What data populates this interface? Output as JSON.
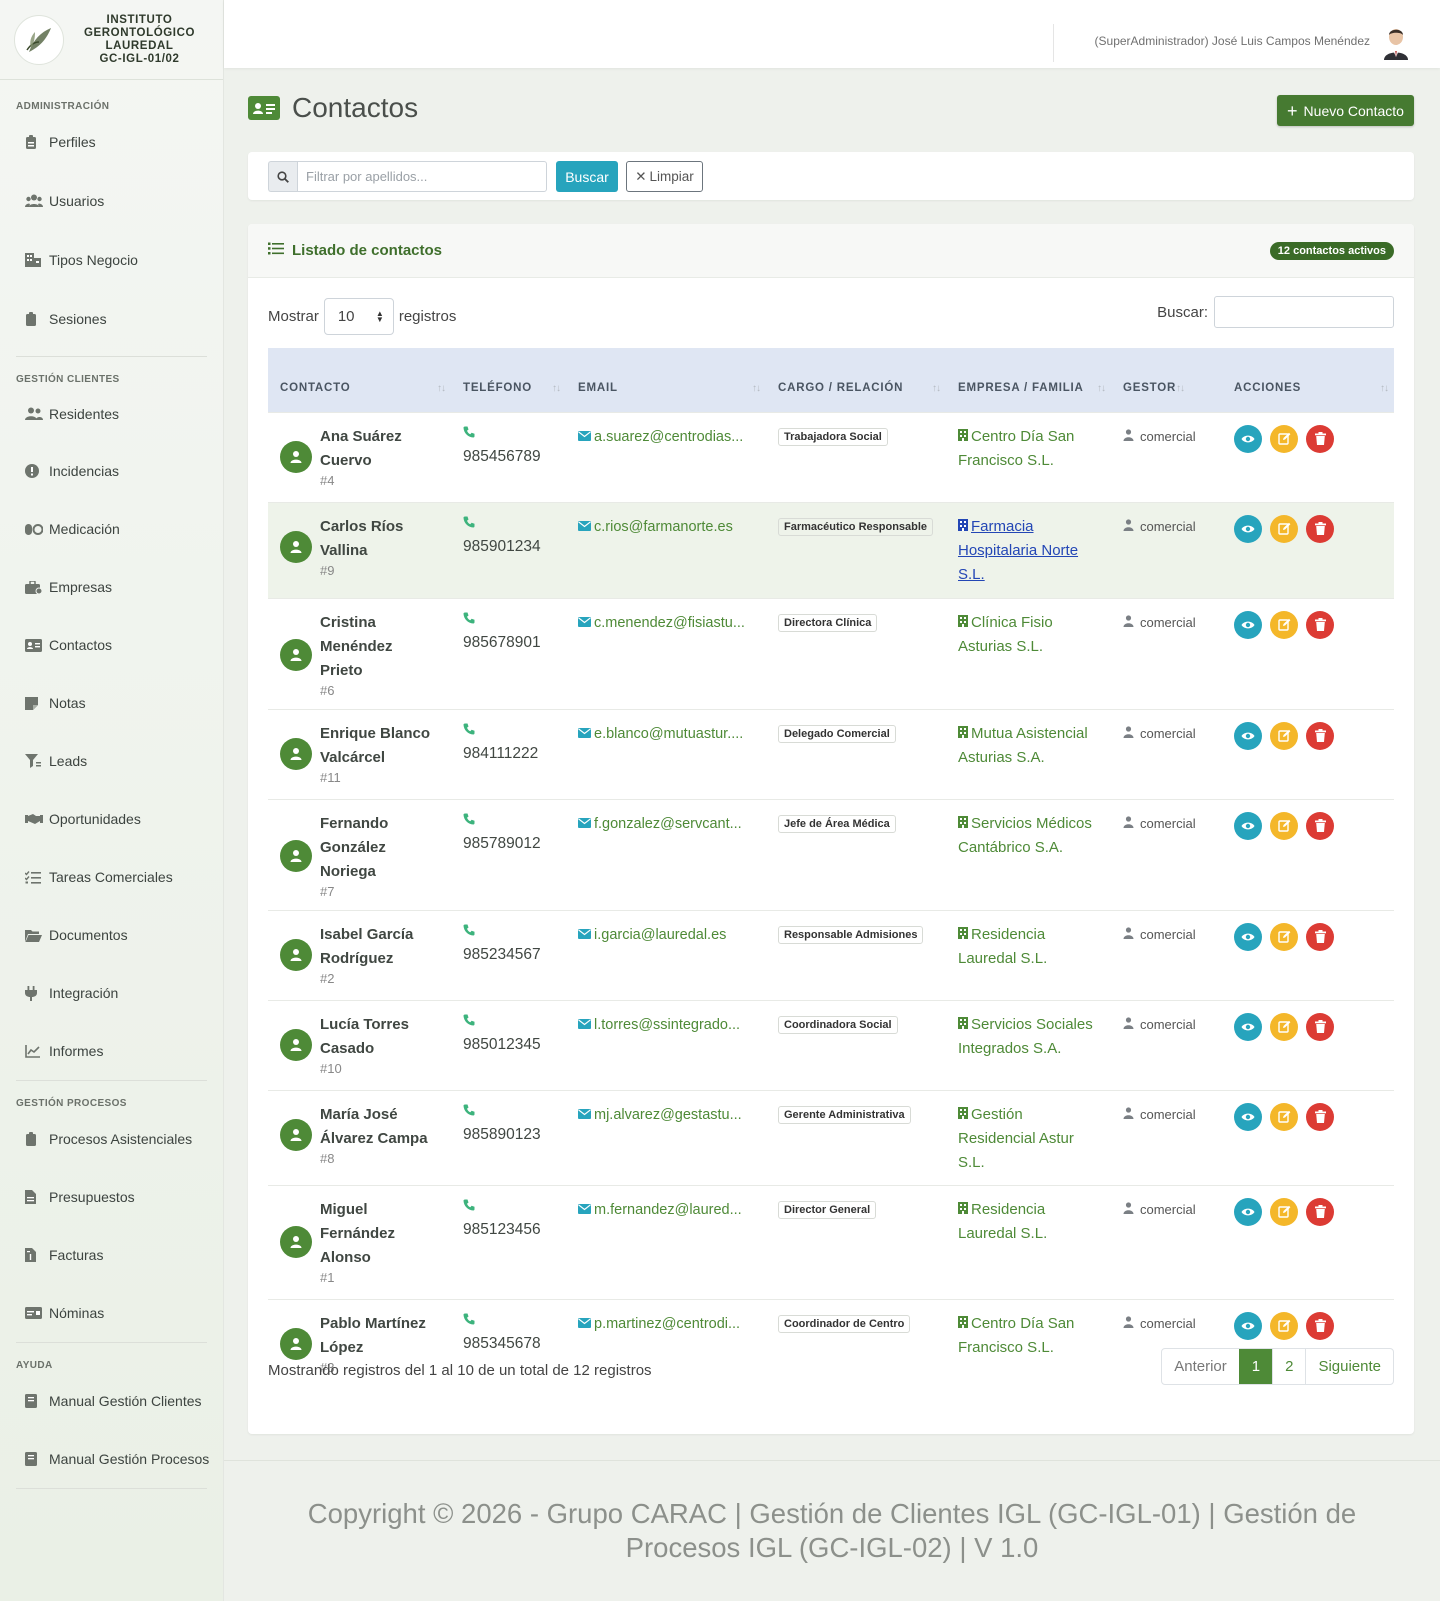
{
  "brand": {
    "lines": [
      "INSTITUTO",
      "GERONTOLÓGICO",
      "LAUREDAL",
      "GC-IGL-01/02"
    ],
    "logo_icon": "leaf-logo-icon"
  },
  "sidebar": {
    "sections": [
      {
        "title": "ADMINISTRACIÓN",
        "items": [
          {
            "label": "Perfiles",
            "icon": "id-badge-icon"
          },
          {
            "label": "Usuarios",
            "icon": "users-icon"
          },
          {
            "label": "Tipos Negocio",
            "icon": "building-icon"
          },
          {
            "label": "Sesiones",
            "icon": "clipboard-icon"
          }
        ]
      },
      {
        "title": "GESTIÓN CLIENTES",
        "items": [
          {
            "label": "Residentes",
            "icon": "user-group-icon"
          },
          {
            "label": "Incidencias",
            "icon": "alert-circle-icon"
          },
          {
            "label": "Medicación",
            "icon": "pills-icon"
          },
          {
            "label": "Empresas",
            "icon": "briefcase-icon"
          },
          {
            "label": "Contactos",
            "icon": "address-card-icon"
          },
          {
            "label": "Notas",
            "icon": "note-icon"
          },
          {
            "label": "Leads",
            "icon": "funnel-icon"
          },
          {
            "label": "Oportunidades",
            "icon": "handshake-icon"
          },
          {
            "label": "Tareas Comerciales",
            "icon": "tasks-icon"
          },
          {
            "label": "Documentos",
            "icon": "folder-open-icon"
          },
          {
            "label": "Integración",
            "icon": "plug-icon"
          },
          {
            "label": "Informes",
            "icon": "chart-line-icon"
          }
        ]
      },
      {
        "title": "GESTIÓN PROCESOS",
        "items": [
          {
            "label": "Procesos Asistenciales",
            "icon": "clipboard-icon"
          },
          {
            "label": "Presupuestos",
            "icon": "file-invoice-icon"
          },
          {
            "label": "Facturas",
            "icon": "file-invoice-dollar-icon"
          },
          {
            "label": "Nóminas",
            "icon": "money-check-icon"
          }
        ]
      },
      {
        "title": "AYUDA",
        "items": [
          {
            "label": "Manual Gestión Clientes",
            "icon": "book-icon"
          },
          {
            "label": "Manual Gestión Procesos",
            "icon": "book-icon"
          }
        ]
      }
    ]
  },
  "topbar": {
    "user": "(SuperAdministrador) José Luis Campos Menéndez"
  },
  "page": {
    "title": "Contactos",
    "new_button": "Nuevo Contacto"
  },
  "filter": {
    "placeholder": "Filtrar por apellidos...",
    "search_button": "Buscar",
    "clear_button": "Limpiar"
  },
  "list": {
    "title": "Listado de contactos",
    "badge": "12 contactos activos",
    "show_label": "Mostrar",
    "page_size": "10",
    "records_label": "registros",
    "search_label": "Buscar:",
    "columns": [
      "CONTACTO",
      "TELÉFONO",
      "EMAIL",
      "CARGO / RELACIÓN",
      "EMPRESA / FAMILIA",
      "GESTOR",
      "ACCIONES"
    ],
    "rows": [
      {
        "name": "Ana Suárez Cuervo",
        "id": "#4",
        "phone": "985456789",
        "email": "a.suarez@centrodias...",
        "cargo": "Trabajadora Social",
        "empresa": "Centro Día San Francisco S.L.",
        "gestor": "comercial"
      },
      {
        "name": "Carlos Ríos Vallina",
        "id": "#9",
        "phone": "985901234",
        "email": "c.rios@farmanorte.es",
        "cargo": "Farmacéutico Responsable",
        "empresa": "Farmacia Hospitalaria Norte S.L.",
        "gestor": "comercial"
      },
      {
        "name": "Cristina Menéndez Prieto",
        "id": "#6",
        "phone": "985678901",
        "email": "c.menendez@fisiastu...",
        "cargo": "Directora Clínica",
        "empresa": "Clínica Fisio Asturias S.L.",
        "gestor": "comercial"
      },
      {
        "name": "Enrique Blanco Valcárcel",
        "id": "#11",
        "phone": "984111222",
        "email": "e.blanco@mutuastur....",
        "cargo": "Delegado Comercial",
        "empresa": "Mutua Asistencial Asturias S.A.",
        "gestor": "comercial"
      },
      {
        "name": "Fernando González Noriega",
        "id": "#7",
        "phone": "985789012",
        "email": "f.gonzalez@servcant...",
        "cargo": "Jefe de Área Médica",
        "empresa": "Servicios Médicos Cantábrico S.A.",
        "gestor": "comercial"
      },
      {
        "name": "Isabel García Rodríguez",
        "id": "#2",
        "phone": "985234567",
        "email": "i.garcia@lauredal.es",
        "cargo": "Responsable Admisiones",
        "empresa": "Residencia Lauredal S.L.",
        "gestor": "comercial"
      },
      {
        "name": "Lucía Torres Casado",
        "id": "#10",
        "phone": "985012345",
        "email": "l.torres@ssintegrado...",
        "cargo": "Coordinadora Social",
        "empresa": "Servicios Sociales Integrados S.A.",
        "gestor": "comercial"
      },
      {
        "name": "María José Álvarez Campa",
        "id": "#8",
        "phone": "985890123",
        "email": "mj.alvarez@gestastu...",
        "cargo": "Gerente Administrativa",
        "empresa": "Gestión Residencial Astur S.L.",
        "gestor": "comercial"
      },
      {
        "name": "Miguel Fernández Alonso",
        "id": "#1",
        "phone": "985123456",
        "email": "m.fernandez@laured...",
        "cargo": "Director General",
        "empresa": "Residencia Lauredal S.L.",
        "gestor": "comercial"
      },
      {
        "name": "Pablo Martínez López",
        "id": "#3",
        "phone": "985345678",
        "email": "p.martinez@centrodi...",
        "cargo": "Coordinador de Centro",
        "empresa": "Centro Día San Francisco S.L.",
        "gestor": "comercial"
      }
    ],
    "info": "Mostrando registros del 1 al 10 de un total de 12 registros",
    "pagination": {
      "prev": "Anterior",
      "pages": [
        "1",
        "2"
      ],
      "next": "Siguiente",
      "active": "1"
    }
  },
  "footer": {
    "line1": "Copyright © 2026 - Grupo CARAC | Gestión de Clientes IGL (GC-IGL-01) | Gestión de",
    "line2": "Procesos IGL (GC-IGL-02) | V 1.0"
  },
  "colors": {
    "brand_green": "#4e8a37",
    "info_cyan": "#27a4bd",
    "warning_yellow": "#f4b72a",
    "danger_red": "#dc3b34",
    "table_header": "#dfe6f3"
  }
}
